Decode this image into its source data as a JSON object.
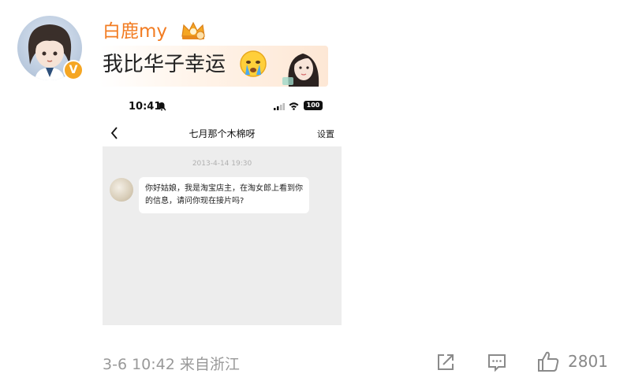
{
  "post": {
    "username": "白鹿my",
    "verified_badge": "V",
    "text": "我比华子幸运",
    "icons": [
      "crown-icon",
      "crying-emoji-icon",
      "girl-sticker-icon"
    ]
  },
  "screenshot": {
    "status_time": "10:41",
    "battery": "100",
    "chat_title": "七月那个木棉呀",
    "settings_label": "设置",
    "message_time": "2013-4-14 19:30",
    "message_text": "你好姑娘，我是淘宝店主，在淘女郎上看到你的信息，请问你现在接片吗?"
  },
  "footer": {
    "meta": "3-6 10:42  来自浙江",
    "like_count": "2801"
  },
  "colors": {
    "username": "#f27c22",
    "footer_text": "#999999",
    "chat_bg": "#ededed"
  }
}
